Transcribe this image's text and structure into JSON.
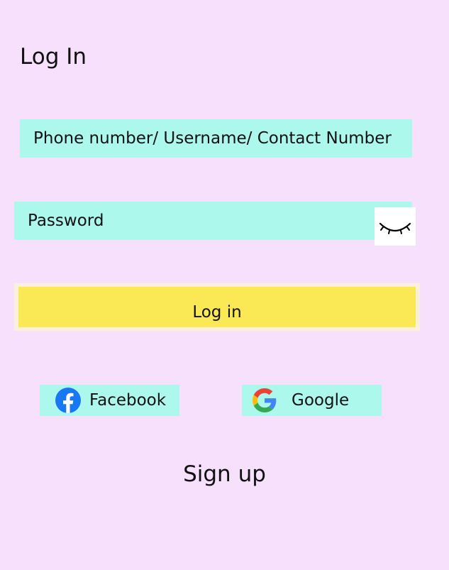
{
  "page": {
    "title": "Log In"
  },
  "form": {
    "username_placeholder": "Phone number/ Username/ Contact Number",
    "username_value": "",
    "password_placeholder": "Password",
    "password_value": "",
    "login_label": "Log in"
  },
  "social": {
    "facebook_label": "Facebook",
    "google_label": "Google"
  },
  "footer": {
    "signup_label": "Sign up"
  },
  "icons": {
    "password_toggle": "eye-closed-icon",
    "facebook": "facebook-icon",
    "google": "google-icon"
  },
  "colors": {
    "background": "#f6e0fc",
    "field": "#adf8ed",
    "login_button": "#fae955",
    "login_border": "#fbf0dc",
    "facebook_blue": "#1877f2"
  }
}
